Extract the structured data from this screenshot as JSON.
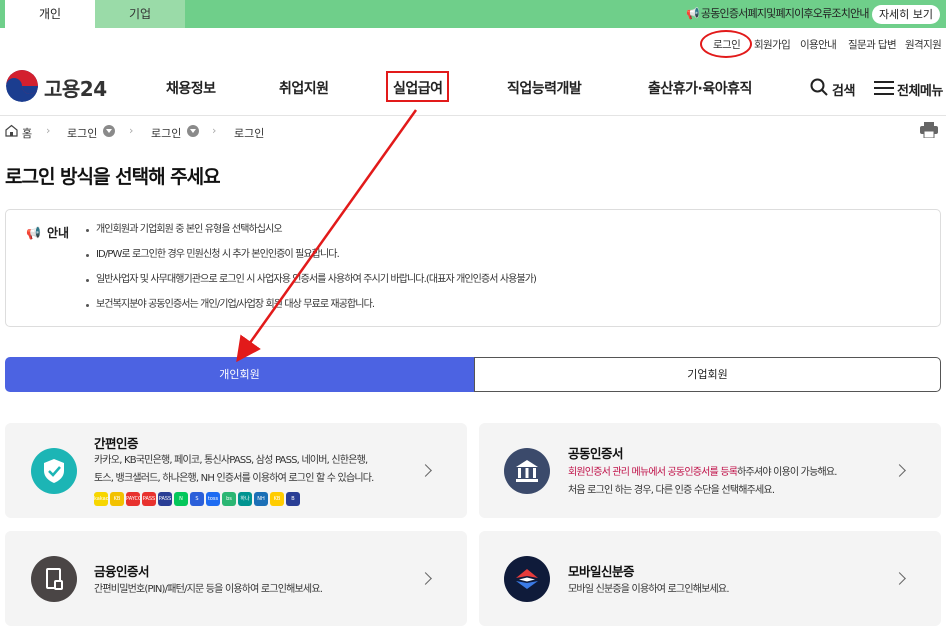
{
  "top_tabs": {
    "personal": "개인",
    "business": "기업"
  },
  "notice": {
    "text": "공동인증서폐지및폐지이후오류조치안내",
    "button": "자세히 보기",
    "icon": "megaphone-icon"
  },
  "util_links": [
    "로그인",
    "회원가입",
    "이용안내",
    "질문과 답변",
    "원격지원"
  ],
  "logo": {
    "text": "고용24"
  },
  "gnb": [
    "채용정보",
    "취업지원",
    "실업급여",
    "직업능력개발",
    "출산휴가·육아휴직"
  ],
  "header_tools": {
    "search": "검색",
    "menu": "전체메뉴"
  },
  "breadcrumb": [
    "홈",
    "로그인",
    "로그인",
    "로그인"
  ],
  "page_title": "로그인 방식을 선택해 주세요",
  "info": {
    "heading": "안내",
    "items": [
      "개인회원과 기업회원 중 본인 유형을 선택하십시오",
      "ID/PW로 로그인한 경우 민원신청 시 추가 본인인증이 필요합니다.",
      "일반사업자 및 사무대행기관으로 로그인 시 사업자용 인증서를 사용하여 주시기 바랍니다.(대표자 개인인증서 사용불가)",
      "보건복지분야 공동인증서는 개인/기업/사업장 회원 대상 무료로 재공합니다."
    ]
  },
  "member_tabs": {
    "personal": "개인회원",
    "business": "기업회원"
  },
  "cards": {
    "simple": {
      "title": "간편인증",
      "desc1": "카카오, KB국민은행, 페이코, 통신사PASS, 삼성 PASS, 네이버, 신한은행,",
      "desc2": "토스, 뱅크샐러드, 하나은행, NH 인증서를 이용하여 로그인 할 수 있습니다."
    },
    "joint": {
      "title": "공동인증서",
      "desc1_highlight": "회원인증서 관리 메뉴에서 공동인증서를 등록",
      "desc1_rest": "하주셔야 이용이 가능해요.",
      "desc2": "처음 로그인 하는 경우, 다른 인증 수단을 선택해주세요."
    },
    "financial": {
      "title": "금융인증서",
      "desc": "간편비밀번호(PIN)/패턴/지문 등을 이용하여 로그인해보세요."
    },
    "mobile": {
      "title": "모바일신분증",
      "desc": "모바일 신분증을 이용하여 로그인해보세요."
    }
  },
  "providers": [
    {
      "label": "kakao",
      "color": "#f7d600"
    },
    {
      "label": "KB",
      "color": "#f2c100"
    },
    {
      "label": "PAYCO",
      "color": "#e8322e"
    },
    {
      "label": "PASS",
      "color": "#e8322e"
    },
    {
      "label": "PASS",
      "color": "#2a3e95"
    },
    {
      "label": "N",
      "color": "#03c75a"
    },
    {
      "label": "S",
      "color": "#2b5fd9"
    },
    {
      "label": "toss",
      "color": "#1e6cf2"
    },
    {
      "label": "bs",
      "color": "#2bb673"
    },
    {
      "label": "하나",
      "color": "#009490"
    },
    {
      "label": "NH",
      "color": "#1b6fb6"
    },
    {
      "label": "KB",
      "color": "#ffcc00"
    },
    {
      "label": "B",
      "color": "#2a3e95"
    }
  ],
  "colors": {
    "green_bar": "#6fcf8a",
    "active_tab": "#4c63e2",
    "highlight": "#e21a1a"
  }
}
